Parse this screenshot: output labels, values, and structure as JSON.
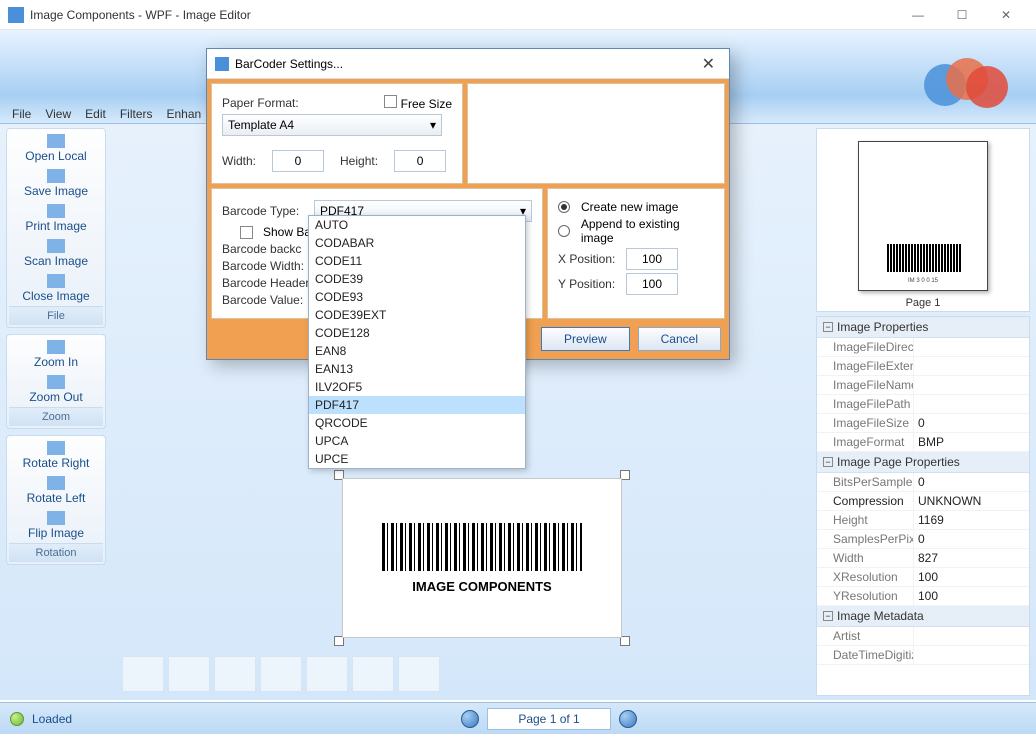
{
  "window": {
    "title": "Image Components - WPF - Image Editor"
  },
  "menu": [
    "File",
    "View",
    "Edit",
    "Filters",
    "Enhan"
  ],
  "toolbar": {
    "file": {
      "items": [
        "Open Local",
        "Save Image",
        "Print Image",
        "Scan Image",
        "Close Image"
      ],
      "label": "File"
    },
    "zoom": {
      "items": [
        "Zoom In",
        "Zoom Out"
      ],
      "label": "Zoom"
    },
    "rotation": {
      "items": [
        "Rotate Right",
        "Rotate Left",
        "Flip Image"
      ],
      "label": "Rotation"
    }
  },
  "canvas": {
    "barcode_text": "IMAGE COMPONENTS"
  },
  "preview_pane": {
    "page_label": "Page 1"
  },
  "props": {
    "cat1": "Image Properties",
    "rows1": [
      {
        "k": "ImageFileDirectc",
        "v": ""
      },
      {
        "k": "ImageFileExtens",
        "v": ""
      },
      {
        "k": "ImageFileName",
        "v": ""
      },
      {
        "k": "ImageFilePath",
        "v": ""
      },
      {
        "k": "ImageFileSize",
        "v": "0"
      },
      {
        "k": "ImageFormat",
        "v": "BMP"
      }
    ],
    "cat2": "Image Page Properties",
    "rows2": [
      {
        "k": "BitsPerSample",
        "v": "0"
      },
      {
        "k": "Compression",
        "v": "UNKNOWN",
        "dark": true
      },
      {
        "k": "Height",
        "v": "1169"
      },
      {
        "k": "SamplesPerPixel",
        "v": "0"
      },
      {
        "k": "Width",
        "v": "827"
      },
      {
        "k": "XResolution",
        "v": "100"
      },
      {
        "k": "YResolution",
        "v": "100"
      }
    ],
    "cat3": "Image Metadata",
    "rows3": [
      {
        "k": "Artist",
        "v": ""
      },
      {
        "k": "DateTimeDigitiz",
        "v": ""
      }
    ]
  },
  "status": {
    "text": "Loaded",
    "page": "Page 1 of 1"
  },
  "dialog": {
    "title": "BarCoder Settings...",
    "paper_format_label": "Paper Format:",
    "free_size": "Free Size",
    "template": "Template A4",
    "width_label": "Width:",
    "width_val": "0",
    "height_label": "Height:",
    "height_val": "0",
    "barcode_type_label": "Barcode Type:",
    "barcode_type": "PDF417",
    "show_barcode": "Show Barc",
    "back_label": "Barcode backc",
    "bwidth_label": "Barcode Width:",
    "bheader_label": "Barcode Header",
    "bvalue_label": "Barcode Value:",
    "create_new": "Create new image",
    "append": "Append to existing image",
    "xpos_label": "X Position:",
    "xpos": "100",
    "ypos_label": "Y Position:",
    "ypos": "100",
    "preview_btn": "Preview",
    "cancel_btn": "Cancel",
    "options": [
      "AUTO",
      "CODABAR",
      "CODE11",
      "CODE39",
      "CODE93",
      "CODE39EXT",
      "CODE128",
      "EAN8",
      "EAN13",
      "ILV2OF5",
      "PDF417",
      "QRCODE",
      "UPCA",
      "UPCE"
    ]
  }
}
